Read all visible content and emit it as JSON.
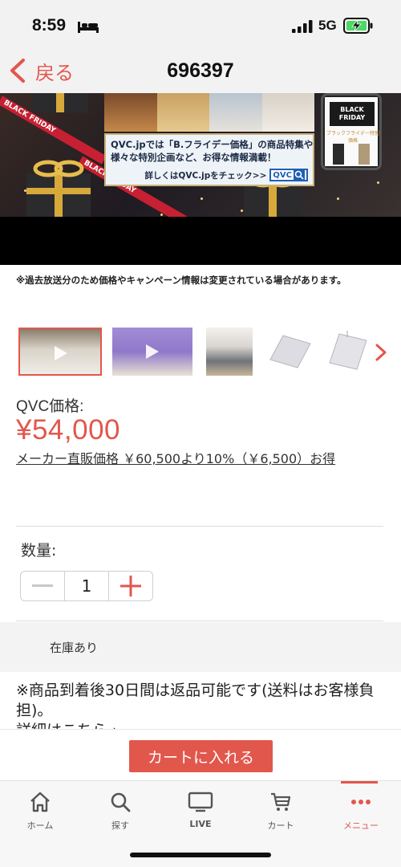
{
  "status_bar": {
    "time": "8:59",
    "network": "5G"
  },
  "nav": {
    "back_label": "戻る",
    "title": "696397"
  },
  "banner": {
    "info_line1": "QVC.jpでは「B.フライデー価格」の商品特集や",
    "info_line2": "様々な特別企画など、お得な情報満載！",
    "cta": "詳しくはQVC.jpをチェック>>",
    "logo": "QVC",
    "phone_promo_line1": "BLACK",
    "phone_promo_line2": "FRIDAY",
    "phone_caption": "ブラックフライデー特別価格",
    "ribbon_text": "BLACK FRIDAY"
  },
  "notice": "※過去放送分のため価格やキャンペーン情報は変更されている場合があります。",
  "thumbnails": [
    {
      "kind": "video",
      "selected": true
    },
    {
      "kind": "video",
      "selected": false
    },
    {
      "kind": "image",
      "selected": false
    },
    {
      "kind": "image",
      "selected": false
    },
    {
      "kind": "image",
      "selected": false
    }
  ],
  "price": {
    "caption": "QVC価格:",
    "value": "¥54,000",
    "maker_price": "メーカー直販価格 ￥60,500より10%（￥6,500）お得"
  },
  "quantity": {
    "label": "数量:",
    "value": "1"
  },
  "stock": {
    "label": "在庫あり"
  },
  "return_note": "※商品到着後30日間は返品可能です(送料はお客様負担)。",
  "details_link": "詳細はこちら ›",
  "cart": {
    "button_label": "カートに入れる"
  },
  "tabs": [
    {
      "label": "ホーム",
      "icon": "home-icon",
      "active": false
    },
    {
      "label": "探す",
      "icon": "search-icon",
      "active": false
    },
    {
      "label": "LIVE",
      "icon": "tv-icon",
      "active": false
    },
    {
      "label": "カート",
      "icon": "cart-icon",
      "active": false
    },
    {
      "label": "メニュー",
      "icon": "menu-dots-icon",
      "active": true
    }
  ],
  "colors": {
    "accent": "#e2574c",
    "text": "#222222",
    "muted_bg": "#f3f3f3"
  }
}
